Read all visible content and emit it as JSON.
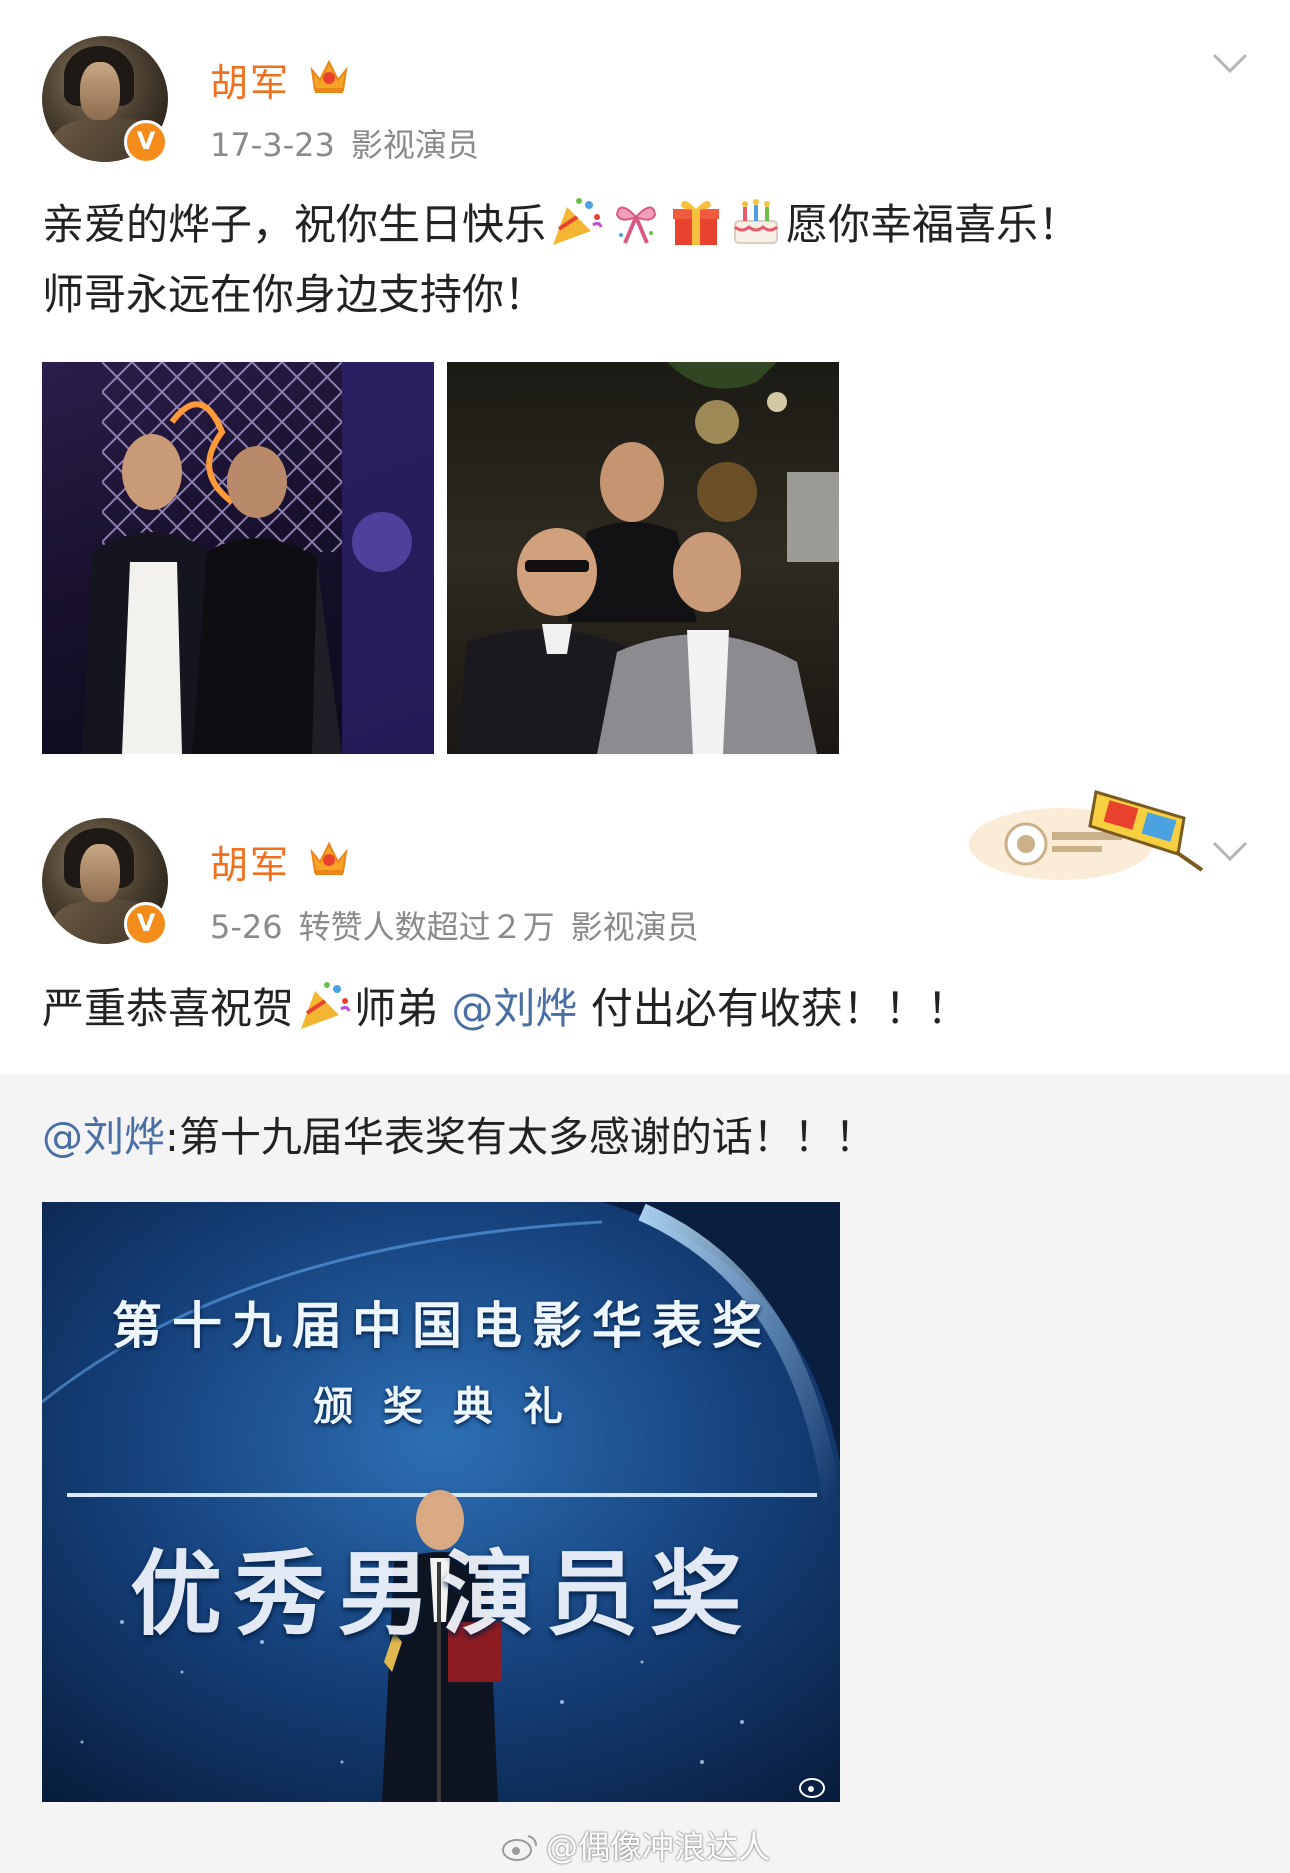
{
  "posts": [
    {
      "username": "胡军",
      "time": "17-3-23",
      "extra": "",
      "source": "影视演员",
      "verified_badge": "V",
      "text_line1_a": "亲爱的烨子，祝你生日快乐",
      "text_line1_b": "愿你幸福喜乐！",
      "text_line2": "师哥永远在你身边支持你！",
      "emojis": [
        "party-popper-icon",
        "ribbon-icon",
        "gift-icon",
        "birthday-cake-icon"
      ]
    },
    {
      "username": "胡军",
      "time": "5-26",
      "extra": "转赞人数超过２万",
      "source": "影视演员",
      "verified_badge": "V",
      "text_a": "严重恭喜祝贺",
      "text_b": "师弟 ",
      "mention": "@刘烨",
      "text_c": " 付出必有收获！！！",
      "decoration": "3d-glasses-badge-icon"
    }
  ],
  "repost": {
    "mention": "@刘烨",
    "text": ":第十九届华表奖有太多感谢的话！！！",
    "image": {
      "line1": "第十九届中国电影华表奖",
      "line2": "颁 奖 典 礼",
      "line3": "优秀男演员奖"
    }
  },
  "watermark": "@偶像冲浪达人",
  "colors": {
    "username": "#f0701e",
    "mention": "#4a6fa5",
    "meta": "#8a8a8a",
    "verified": "#f48c1c"
  }
}
